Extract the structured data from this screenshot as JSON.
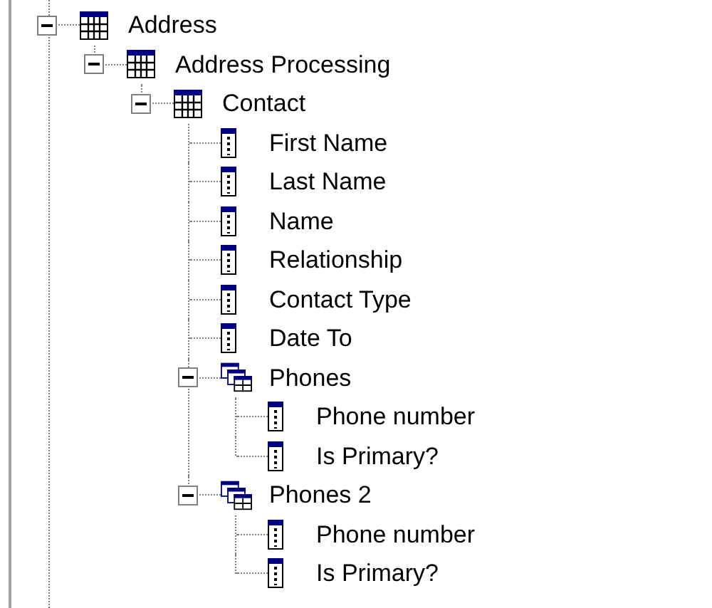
{
  "tree": [
    {
      "label": "Address",
      "kind": "table",
      "expanded": true,
      "children": [
        {
          "label": "Address Processing",
          "kind": "table",
          "expanded": true,
          "children": [
            {
              "label": "Contact",
              "kind": "table",
              "expanded": true,
              "children": [
                {
                  "label": "First Name",
                  "kind": "field"
                },
                {
                  "label": "Last Name",
                  "kind": "field"
                },
                {
                  "label": "Name",
                  "kind": "field"
                },
                {
                  "label": "Relationship",
                  "kind": "field"
                },
                {
                  "label": "Contact Type",
                  "kind": "field"
                },
                {
                  "label": "Date To",
                  "kind": "field"
                },
                {
                  "label": "Phones",
                  "kind": "group",
                  "expanded": true,
                  "children": [
                    {
                      "label": "Phone number",
                      "kind": "field"
                    },
                    {
                      "label": "Is Primary?",
                      "kind": "field"
                    }
                  ]
                },
                {
                  "label": "Phones 2",
                  "kind": "group",
                  "expanded": true,
                  "children": [
                    {
                      "label": "Phone number",
                      "kind": "field"
                    },
                    {
                      "label": "Is Primary?",
                      "kind": "field"
                    }
                  ]
                }
              ]
            }
          ]
        }
      ]
    }
  ]
}
